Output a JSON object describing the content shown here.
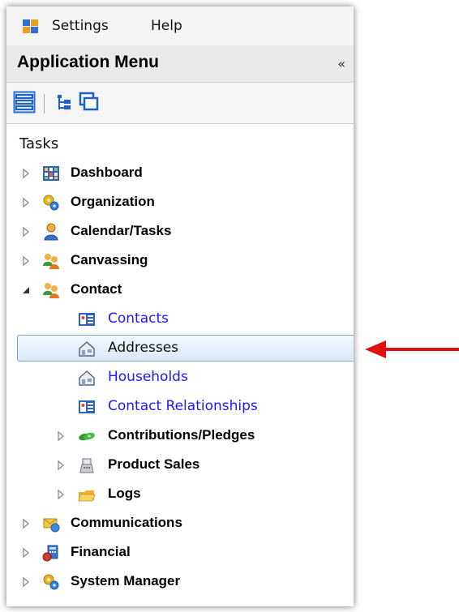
{
  "menubar": {
    "settings_label": "Settings",
    "help_label": "Help"
  },
  "panel": {
    "title": "Application Menu",
    "collapse_glyph": "«"
  },
  "toolbar": {
    "buttons": [
      "list-view-icon",
      "tree-view-icon",
      "windows-icon"
    ]
  },
  "tasks": {
    "heading": "Tasks",
    "items": [
      {
        "label": "Dashboard",
        "icon": "dashboard-icon",
        "expanded": false
      },
      {
        "label": "Organization",
        "icon": "organization-icon",
        "expanded": false
      },
      {
        "label": "Calendar/Tasks",
        "icon": "calendar-tasks-icon",
        "expanded": false
      },
      {
        "label": "Canvassing",
        "icon": "canvassing-icon",
        "expanded": false
      },
      {
        "label": "Contact",
        "icon": "contact-icon",
        "expanded": true,
        "children": [
          {
            "label": "Contacts",
            "icon": "contact-card-icon"
          },
          {
            "label": "Addresses",
            "icon": "house-icon",
            "selected": true
          },
          {
            "label": "Households",
            "icon": "house-icon"
          },
          {
            "label": "Contact Relationships",
            "icon": "contact-card-icon"
          },
          {
            "label": "Contributions/Pledges",
            "icon": "money-icon",
            "expandable": true
          },
          {
            "label": "Product Sales",
            "icon": "register-icon",
            "expandable": true
          },
          {
            "label": "Logs",
            "icon": "folder-icon",
            "expandable": true
          }
        ]
      },
      {
        "label": "Communications",
        "icon": "communications-icon",
        "expanded": false
      },
      {
        "label": "Financial",
        "icon": "financial-icon",
        "expanded": false
      },
      {
        "label": "System Manager",
        "icon": "system-manager-icon",
        "expanded": false
      }
    ]
  },
  "colors": {
    "link": "#1a1aff",
    "selection_border": "#7da2ce",
    "arrow": "#e01010"
  }
}
